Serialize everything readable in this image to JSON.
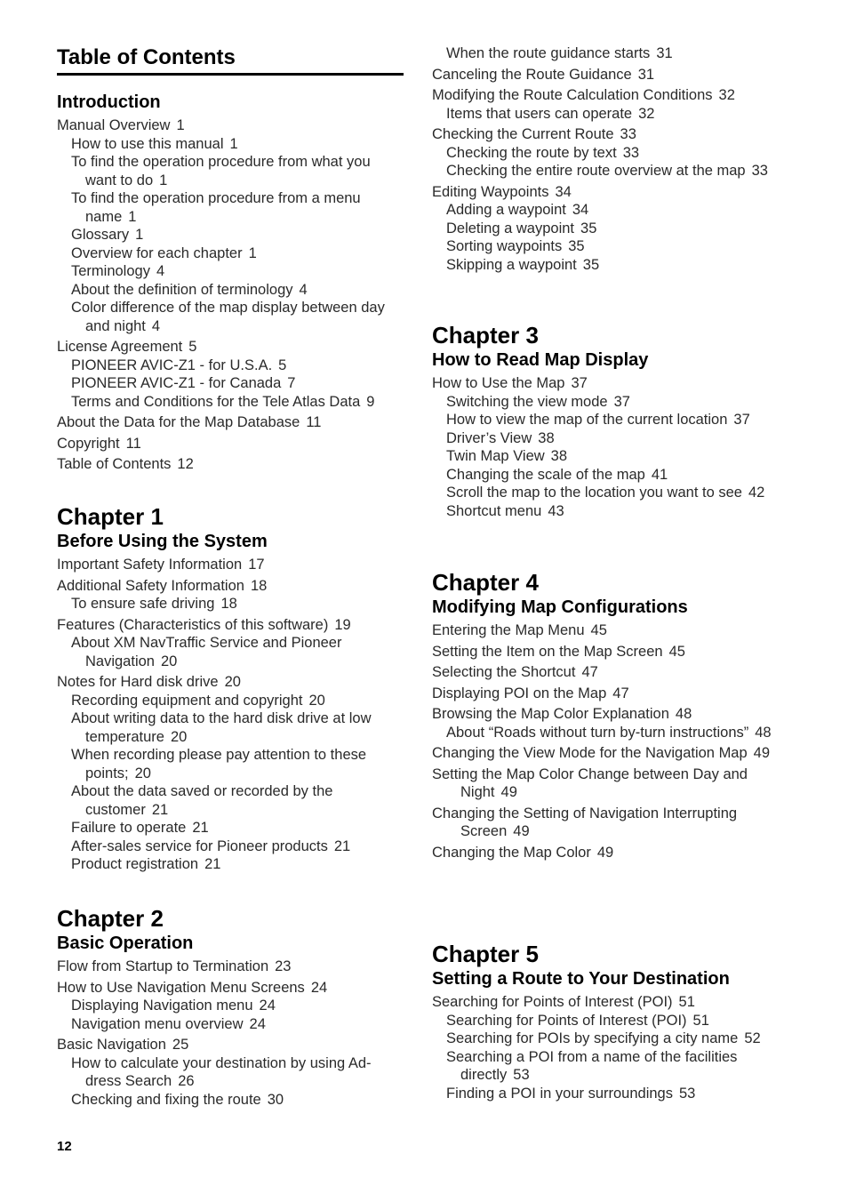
{
  "page": {
    "title": "Table of Contents",
    "page_number": "12"
  },
  "left_column": {
    "introduction": {
      "heading": "Introduction",
      "entries": [
        {
          "level": 1,
          "text": "Manual Overview",
          "page": "1"
        },
        {
          "level": 2,
          "text": "How to use this manual",
          "page": "1"
        },
        {
          "level": 2,
          "text": "To find the operation procedure from what you want to do",
          "page": "1"
        },
        {
          "level": 2,
          "text": "To find the operation procedure from a menu name",
          "page": "1"
        },
        {
          "level": 2,
          "text": "Glossary",
          "page": "1"
        },
        {
          "level": 2,
          "text": "Overview for each chapter",
          "page": "1"
        },
        {
          "level": 2,
          "text": "Terminology",
          "page": "4"
        },
        {
          "level": 2,
          "text": "About the definition of terminology",
          "page": "4"
        },
        {
          "level": 2,
          "text": "Color difference of the map display between day and night",
          "page": "4"
        },
        {
          "level": 1,
          "text": "License Agreement",
          "page": "5"
        },
        {
          "level": 2,
          "text": "PIONEER AVIC-Z1 - for U.S.A.",
          "page": "5"
        },
        {
          "level": 2,
          "text": "PIONEER AVIC-Z1 - for Canada",
          "page": "7"
        },
        {
          "level": 2,
          "text": "Terms and Conditions for the Tele Atlas Data",
          "page": "9"
        },
        {
          "level": 1,
          "text": "About the Data for the Map Database",
          "page": "11"
        },
        {
          "level": 1,
          "text": "Copyright",
          "page": "11"
        },
        {
          "level": 1,
          "text": "Table of Contents",
          "page": "12"
        }
      ]
    },
    "chapter1": {
      "label": "Chapter  1",
      "title": "Before Using the System",
      "entries": [
        {
          "level": 1,
          "text": "Important Safety Information",
          "page": "17"
        },
        {
          "level": 1,
          "text": "Additional Safety Information",
          "page": "18"
        },
        {
          "level": 2,
          "text": "To ensure safe driving",
          "page": "18"
        },
        {
          "level": 1,
          "text": "Features (Characteristics of this software)",
          "page": "19"
        },
        {
          "level": 2,
          "text": "About XM NavTraffic Service and Pioneer Navigation",
          "page": "20"
        },
        {
          "level": 1,
          "text": "Notes for Hard disk drive",
          "page": "20"
        },
        {
          "level": 2,
          "text": "Recording equipment and copyright",
          "page": "20"
        },
        {
          "level": 2,
          "text": "About writing data to the hard disk drive at low temperature",
          "page": "20"
        },
        {
          "level": 2,
          "text": "When recording please pay attention to these points;",
          "page": "20"
        },
        {
          "level": 2,
          "text": "About the data saved or recorded by the customer",
          "page": "21"
        },
        {
          "level": 2,
          "text": "Failure to operate",
          "page": "21"
        },
        {
          "level": 2,
          "text": "After-sales service for Pioneer products",
          "page": "21"
        },
        {
          "level": 2,
          "text": "Product registration",
          "page": "21"
        }
      ]
    },
    "chapter2": {
      "label": "Chapter  2",
      "title": "Basic Operation",
      "entries": [
        {
          "level": 1,
          "text": "Flow from Startup to Termination",
          "page": "23"
        },
        {
          "level": 1,
          "text": "How to Use Navigation Menu Screens",
          "page": "24"
        },
        {
          "level": 2,
          "text": "Displaying Navigation menu",
          "page": "24"
        },
        {
          "level": 2,
          "text": "Navigation menu overview",
          "page": "24"
        },
        {
          "level": 1,
          "text": "Basic Navigation",
          "page": "25"
        },
        {
          "level": 2,
          "text": "How to calculate your destination by using Ad-dress Search",
          "page": "26"
        },
        {
          "level": 2,
          "text": "Checking and fixing the route",
          "page": "30"
        }
      ]
    }
  },
  "right_column": {
    "chapter2_cont": {
      "entries": [
        {
          "level": 2,
          "text": "When the route guidance starts",
          "page": "31"
        },
        {
          "level": 1,
          "text": "Canceling the Route Guidance",
          "page": "31"
        },
        {
          "level": 1,
          "text": "Modifying the Route Calculation Conditions",
          "page": "32"
        },
        {
          "level": 2,
          "text": "Items that users can operate",
          "page": "32"
        },
        {
          "level": 1,
          "text": "Checking the Current Route",
          "page": "33"
        },
        {
          "level": 2,
          "text": "Checking the route by text",
          "page": "33"
        },
        {
          "level": 2,
          "text": "Checking the entire route overview at the map",
          "page": "33"
        },
        {
          "level": 1,
          "text": "Editing Waypoints",
          "page": "34"
        },
        {
          "level": 2,
          "text": "Adding a waypoint",
          "page": "34"
        },
        {
          "level": 2,
          "text": "Deleting a waypoint",
          "page": "35"
        },
        {
          "level": 2,
          "text": "Sorting waypoints",
          "page": "35"
        },
        {
          "level": 2,
          "text": "Skipping a waypoint",
          "page": "35"
        }
      ]
    },
    "chapter3": {
      "label": "Chapter  3",
      "title": "How to Read Map Display",
      "entries": [
        {
          "level": 1,
          "text": "How to Use the Map",
          "page": "37"
        },
        {
          "level": 2,
          "text": "Switching the view mode",
          "page": "37"
        },
        {
          "level": 2,
          "text": "How to view the map of the current location",
          "page": "37"
        },
        {
          "level": 2,
          "text": "Driver’s View",
          "page": "38"
        },
        {
          "level": 2,
          "text": "Twin Map View",
          "page": "38"
        },
        {
          "level": 2,
          "text": "Changing the scale of the map",
          "page": "41"
        },
        {
          "level": 2,
          "text": "Scroll the map to the location you want to see",
          "page": "42"
        },
        {
          "level": 2,
          "text": "Shortcut menu",
          "page": "43"
        }
      ]
    },
    "chapter4": {
      "label": "Chapter  4",
      "title": "Modifying Map Configurations",
      "entries": [
        {
          "level": 1,
          "text": "Entering the Map Menu",
          "page": "45"
        },
        {
          "level": 1,
          "text": "Setting the Item on the Map Screen",
          "page": "45"
        },
        {
          "level": 1,
          "text": "Selecting the Shortcut",
          "page": "47"
        },
        {
          "level": 1,
          "text": "Displaying POI on the Map",
          "page": "47"
        },
        {
          "level": 1,
          "text": "Browsing the Map Color Explanation",
          "page": "48"
        },
        {
          "level": 2,
          "text": "About “Roads without turn by-turn instructions”",
          "page": "48"
        },
        {
          "level": 1,
          "text": "Changing the View Mode for the Navigation Map",
          "page": "49"
        },
        {
          "level": 1,
          "text": "Setting the Map Color Change between Day and Night",
          "page": "49"
        },
        {
          "level": 1,
          "text": "Changing the Setting of Navigation Interrupting Screen",
          "page": "49"
        },
        {
          "level": 1,
          "text": "Changing the Map Color",
          "page": "49"
        }
      ]
    },
    "chapter5": {
      "label": "Chapter  5",
      "title": "Setting a Route to Your Destination",
      "entries": [
        {
          "level": 1,
          "text": "Searching for Points of Interest (POI)",
          "page": "51"
        },
        {
          "level": 2,
          "text": "Searching for Points of Interest (POI)",
          "page": "51"
        },
        {
          "level": 2,
          "text": "Searching for POIs by specifying a city name",
          "page": "52"
        },
        {
          "level": 2,
          "text": "Searching a POI from a name of the facilities directly",
          "page": "53"
        },
        {
          "level": 2,
          "text": "Finding a POI in your surroundings",
          "page": "53"
        }
      ]
    }
  }
}
